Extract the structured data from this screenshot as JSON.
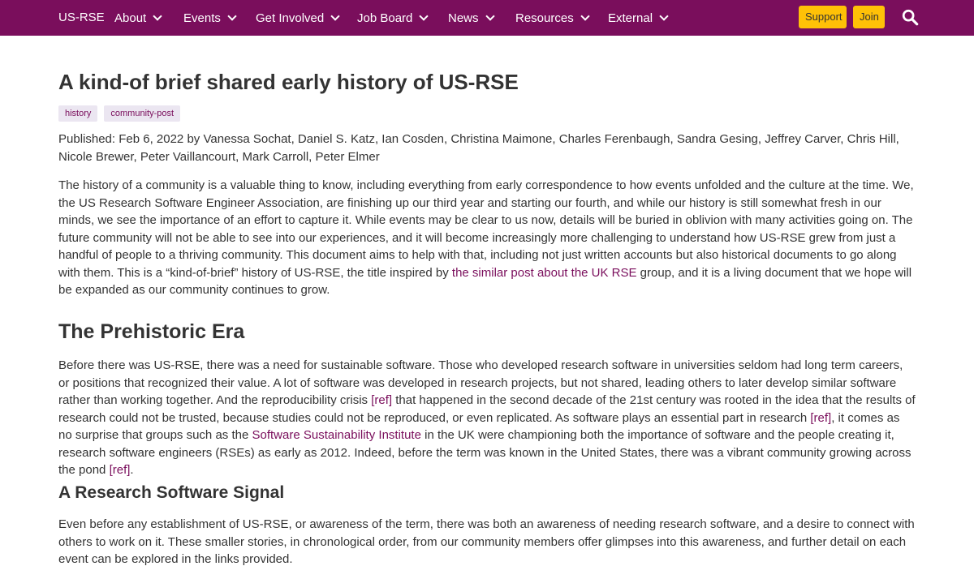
{
  "nav": {
    "brand": "US-RSE",
    "items": [
      {
        "label": "About"
      },
      {
        "label": "Events"
      },
      {
        "label": "Get Involved"
      },
      {
        "label": "Job Board"
      },
      {
        "label": "News"
      },
      {
        "label": "Resources"
      },
      {
        "label": "External"
      }
    ],
    "support_label": "Support",
    "join_label": "Join",
    "search_icon": "search-icon"
  },
  "colors": {
    "brand": "#7a0e5c",
    "button": "#ffc107",
    "tag_bg": "#ebe6f1"
  },
  "article": {
    "title": "A kind-of brief shared early history of US-RSE",
    "tags": [
      "history",
      "community-post"
    ],
    "meta": "Published: Feb 6, 2022 by Vanessa Sochat, Daniel S. Katz, Ian Cosden, Christina Maimone, Charles Ferenbaugh, Sandra Gesing, Jeffrey Carver, Chris Hill, Nicole Brewer, Peter Vaillancourt, Mark Carroll, Peter Elmer",
    "intro": {
      "text1": "The history of a community is a valuable thing to know, including everything from early correspondence to how events unfolded and the culture at the time. We, the US Research Software Engineer Association, are finishing up our third year and starting our fourth, and while our history is still somewhat fresh in our minds, we see the importance of an effort to capture it. While events may be clear to us now, details will be buried in oblivion with many activities going on. The future community will not be able to see into our experiences, and it will become increasingly more challenging to understand how US-RSE grew from just a handful of people to a thriving community. This document aims to help with that, including not just written accounts but also historical documents to go along with them. This is a “kind-of-brief” history of US-RSE, the title inspired by ",
      "link": "the similar post about the UK RSE",
      "text2": " group, and it is a living document that we hope will be expanded as our community continues to grow."
    },
    "section1": {
      "heading": "The Prehistoric Era",
      "t1": "Before there was US-RSE, there was a need for sustainable software. Those who developed research software in universities seldom had long term careers, or positions that recognized their value. A lot of software was developed in research projects, but not shared, leading others to later develop similar software rather than working together. And the reproducibility crisis ",
      "ref1": "[ref]",
      "t2": " that happened in the second decade of the 21st century was rooted in the idea that the results of research could not be trusted, because studies could not be reproduced, or even replicated. As software plays an essential part in research ",
      "ref2": "[ref]",
      "t3": ", it comes as no surprise that groups such as the ",
      "ssi": "Software Sustainability Institute",
      "t4": " in the UK were championing both the importance of software and the people creating it, research software engineers (RSEs) as early as 2012. Indeed, before the term was known in the United States, there was a vibrant community growing across the pond ",
      "ref3": "[ref]",
      "t5": "."
    },
    "section2": {
      "heading": "A Research Software Signal",
      "text": "Even before any establishment of US-RSE, or awareness of the term, there was both an awareness of needing research software, and a desire to connect with others to work on it. These smaller stories, in chronological order, from our community members offer glimpses into this awareness, and further detail on each event can be explored in the links provided."
    }
  }
}
